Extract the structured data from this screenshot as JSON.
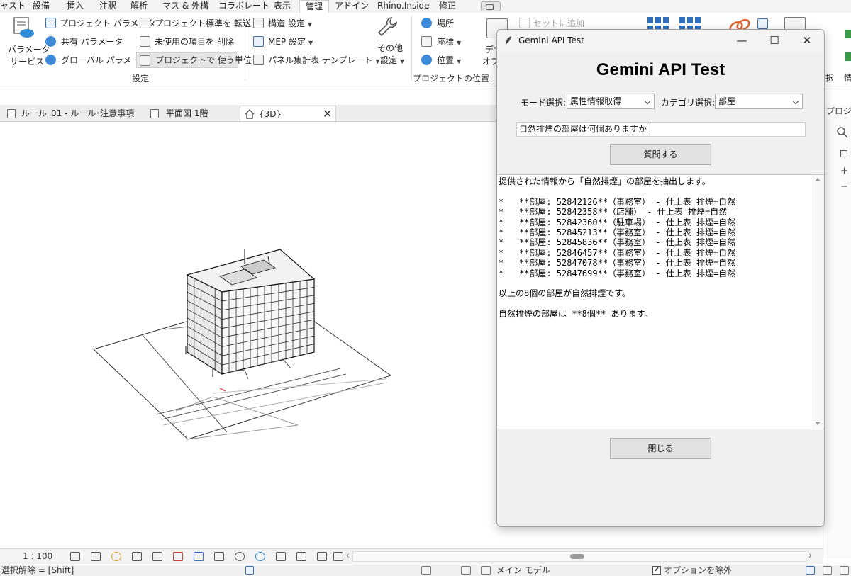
{
  "ribbon_tabs": [
    "ャスト",
    "設備",
    "挿入",
    "注釈",
    "解析",
    "マス & 外構",
    "コラボレート",
    "表示",
    "管理",
    "アドイン",
    "Rhino.Inside",
    "修正"
  ],
  "ribbon": {
    "param_service": [
      "パラメータ",
      "サービス"
    ],
    "project_params": "プロジェクト パラメータ",
    "shared_params": "共有 パラメータ",
    "global_params": "グローバル パラメータ",
    "transfer_standards": "プロジェクト標準を 転送",
    "purge_unused": "未使用の項目を 削除",
    "project_units": "プロジェクトで 使う単位",
    "structural_settings": "構造 設定",
    "mep_settings": "MEP 設定",
    "panel_schedule_templates": "パネル集計表 テンプレート",
    "other_settings": [
      "その他",
      "設定"
    ],
    "settings_group": "設定",
    "location": "場所",
    "coordinates": "座標",
    "position": "位置",
    "project_location_group": "プロジェクトの位置",
    "design_options_partial": [
      "デザ",
      "オプ"
    ],
    "add_to_set": "セットに追加",
    "right_partial": [
      "択",
      "情"
    ]
  },
  "view_tabs": [
    {
      "label": "ルール_01 - ルール･注意事項"
    },
    {
      "label": "平面図 1階"
    },
    {
      "label": "{3D}",
      "close": "✕"
    }
  ],
  "right_panel_partial": "プロジェ",
  "view_control": {
    "scale": "1 : 100"
  },
  "status_bar": {
    "hint": "選択解除 = [Shift]",
    "main_model": "メイン モデル",
    "exclude_options": "オプションを除外"
  },
  "dialog": {
    "window_title": "Gemini API Test",
    "window_controls": {
      "minimize": "—",
      "maximize": "☐",
      "close": "✕"
    },
    "heading": "Gemini API Test",
    "mode_label": "モード選択:",
    "mode_value": "属性情報取得",
    "category_label": "カテゴリ選択:",
    "category_value": "部屋",
    "question_value": "自然排煙の部屋は何個ありますか",
    "ask_button": "質問する",
    "response_lines": [
      "提供された情報から「自然排煙」の部屋を抽出します。",
      "",
      "*   **部屋: 52842126**（事務室） - 仕上表 排煙=自然",
      "*   **部屋: 52842358**（店舗） - 仕上表 排煙=自然",
      "*   **部屋: 52842360**（駐車場） - 仕上表 排煙=自然",
      "*   **部屋: 52845213**（事務室） - 仕上表 排煙=自然",
      "*   **部屋: 52845836**（事務室） - 仕上表 排煙=自然",
      "*   **部屋: 52846457**（事務室） - 仕上表 排煙=自然",
      "*   **部屋: 52847078**（事務室） - 仕上表 排煙=自然",
      "*   **部屋: 52847699**（事務室） - 仕上表 排煙=自然",
      "",
      "以上の8個の部屋が自然排煙です。",
      "",
      "自然排煙の部屋は **8個** あります。"
    ],
    "close_button": "閉じる"
  }
}
